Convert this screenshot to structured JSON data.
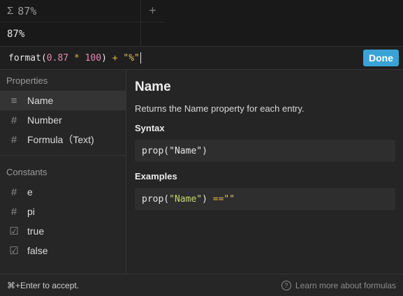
{
  "table": {
    "column_header": "87%",
    "sigma_glyph": "Σ",
    "add_column_glyph": "+",
    "cell_value": "87%"
  },
  "formula_bar": {
    "tokens": {
      "fn": "format",
      "open": "(",
      "num1": "0.87",
      "op1": "*",
      "num2": "100",
      "close": ")",
      "op2": "+",
      "str": "\"%\""
    },
    "done_label": "Done"
  },
  "sidebar": {
    "properties_title": "Properties",
    "properties": [
      {
        "label": "Name",
        "icon": "text-lines-icon",
        "glyph": "≡"
      },
      {
        "label": "Number",
        "icon": "hash-icon",
        "glyph": "#"
      },
      {
        "label": "Formula（Text)",
        "icon": "hash-icon",
        "glyph": "#"
      }
    ],
    "constants_title": "Constants",
    "constants": [
      {
        "label": "e",
        "icon": "hash-icon",
        "glyph": "#"
      },
      {
        "label": "pi",
        "icon": "hash-icon",
        "glyph": "#"
      },
      {
        "label": "true",
        "icon": "checkbox-icon",
        "glyph": "☑"
      },
      {
        "label": "false",
        "icon": "checkbox-icon",
        "glyph": "☑"
      }
    ]
  },
  "detail": {
    "title": "Name",
    "description": "Returns the Name property for each entry.",
    "syntax_label": "Syntax",
    "syntax_code": "prop(\"Name\")",
    "examples_label": "Examples",
    "example": {
      "prefix": "prop(",
      "arg": "\"Name\"",
      "suffix": ") ",
      "op": "==",
      "value": " \"\""
    }
  },
  "footer": {
    "accept_hint": "⌘+Enter to accept.",
    "help_glyph": "?",
    "learn_more": "Learn more about formulas"
  },
  "colors": {
    "accent": "#3aa3d6",
    "background": "#191919",
    "popup": "#252525"
  }
}
